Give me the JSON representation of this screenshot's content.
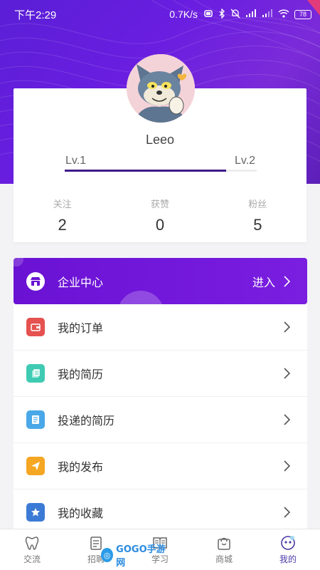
{
  "status_bar": {
    "time": "下午2:29",
    "network_speed": "0.7K/s",
    "battery": "78"
  },
  "profile": {
    "username": "Leeo",
    "level_current": "Lv.1",
    "level_next": "Lv.2",
    "level_progress": 0.84
  },
  "stats": [
    {
      "label": "关注",
      "value": "2"
    },
    {
      "label": "获赞",
      "value": "0"
    },
    {
      "label": "粉丝",
      "value": "5"
    }
  ],
  "enterprise": {
    "label": "企业中心",
    "action": "进入",
    "icon": "store-icon"
  },
  "menu": [
    {
      "label": "我的订单",
      "icon": "wallet-icon",
      "color": "#e5524f"
    },
    {
      "label": "我的简历",
      "icon": "document-icon",
      "color": "#3fcbb3"
    },
    {
      "label": "投递的简历",
      "icon": "sent-resume-icon",
      "color": "#4aa8e8"
    },
    {
      "label": "我的发布",
      "icon": "paper-plane-icon",
      "color": "#f5a623"
    },
    {
      "label": "我的收藏",
      "icon": "star-icon",
      "color": "#3b7bd6"
    }
  ],
  "tabs": [
    {
      "label": "交流",
      "icon": "tooth-icon",
      "active": false
    },
    {
      "label": "招聘",
      "icon": "clipboard-icon",
      "active": false
    },
    {
      "label": "学习",
      "icon": "book-icon",
      "active": false
    },
    {
      "label": "商城",
      "icon": "shopping-bag-icon",
      "active": false
    },
    {
      "label": "我的",
      "icon": "profile-icon",
      "active": true
    }
  ],
  "watermark": {
    "text": "GOGO手游网"
  },
  "colors": {
    "brand_purple": "#6a12d4",
    "active_tab": "#4a3aa8"
  }
}
